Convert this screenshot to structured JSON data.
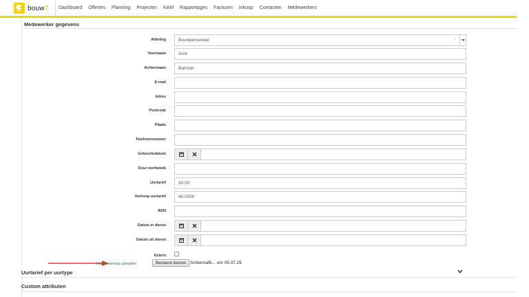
{
  "brand": {
    "name": "bouw",
    "suffix": "7"
  },
  "nav": [
    "Dashboard",
    "Offertes",
    "Planning",
    "Projecten",
    "KAM",
    "Rapportages",
    "Facturen",
    "Inkoop",
    "Contacten",
    "Medewerkers"
  ],
  "panel": {
    "title": "Medewerker gegevens"
  },
  "form": {
    "afdeling": {
      "label": "Afdeling",
      "value": "Bouwpersoneel",
      "clear": "×"
    },
    "voornaam": {
      "label": "Voornaam",
      "value": "Amir"
    },
    "achternaam": {
      "label": "Achternaam",
      "value": "Bahmai"
    },
    "email": {
      "label": "E-mail",
      "value": ""
    },
    "adres": {
      "label": "Adres",
      "value": ""
    },
    "postcode": {
      "label": "Postcode",
      "value": ""
    },
    "plaats": {
      "label": "Plaats",
      "value": ""
    },
    "telefoon": {
      "label": "Telefoonnummer",
      "value": ""
    },
    "geboortedatum": {
      "label": "Geboortedatum",
      "value": ""
    },
    "duur": {
      "label": "Duur werkweek",
      "value": ""
    },
    "uurtarief": {
      "label": "Uurtarief",
      "value": "30.00"
    },
    "verkoop": {
      "label": "Verkoop uurtarief",
      "value": "40.0000"
    },
    "bsn": {
      "label": "BSN",
      "value": ""
    },
    "in_dienst": {
      "label": "Datum in dienst",
      "value": ""
    },
    "uit_dienst": {
      "label": "Datum uit dienst",
      "value": ""
    },
    "extern": {
      "label": "Extern",
      "checked": false
    },
    "handtekening": {
      "label": "Handtekening uploaden",
      "button": "Bestand kiezen",
      "filename": "Schermafb... om 09.37.29"
    }
  },
  "sections": {
    "uurtarief": "Uurtarief per uurtype",
    "custom": "Custom attributen"
  },
  "colors": {
    "accent": "#f1d400",
    "upload_label": "#2e7d32",
    "arrow": "#e53935"
  }
}
